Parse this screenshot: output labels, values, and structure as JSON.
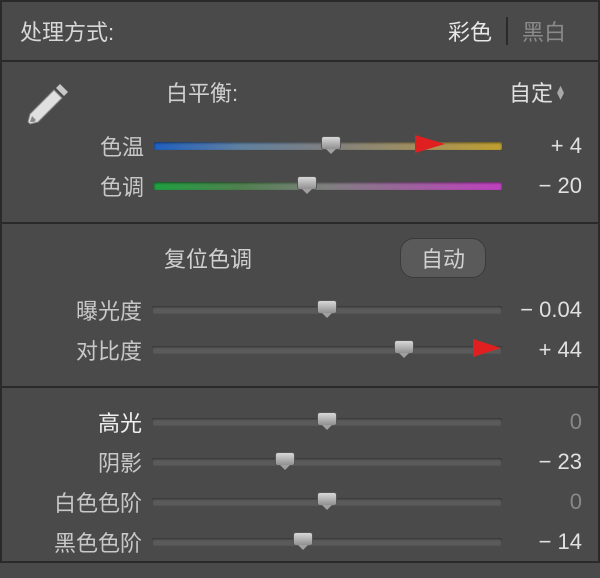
{
  "header": {
    "label": "处理方式:",
    "mode_color": "彩色",
    "mode_bw": "黑白"
  },
  "white_balance": {
    "label": "白平衡:",
    "preset": "自定",
    "temp_label": "色温",
    "temp_value": "+ 4",
    "tint_label": "色调",
    "tint_value": "− 20"
  },
  "tone": {
    "title": "复位色调",
    "auto": "自动",
    "exposure_label": "曝光度",
    "exposure_value": "− 0.04",
    "contrast_label": "对比度",
    "contrast_value": "+ 44"
  },
  "presence": {
    "highlights_label": "高光",
    "highlights_value": "0",
    "shadows_label": "阴影",
    "shadows_value": "− 23",
    "whites_label": "白色色阶",
    "whites_value": "0",
    "blacks_label": "黑色色阶",
    "blacks_value": "− 14"
  }
}
